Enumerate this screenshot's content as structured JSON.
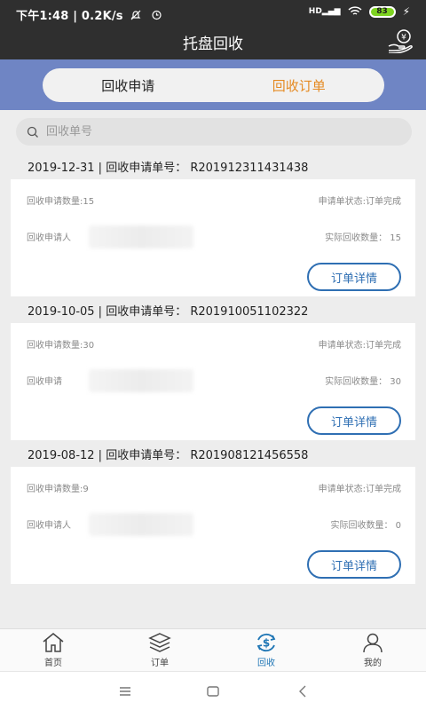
{
  "status_bar": {
    "left_text": "下午1:48 | 0.2K/s",
    "signal_text": "HD",
    "battery": "83"
  },
  "header": {
    "title": "托盘回收"
  },
  "tabs": [
    {
      "label": "回收申请",
      "active": true
    },
    {
      "label": "回收订单",
      "active": false
    }
  ],
  "search": {
    "placeholder": "回收单号"
  },
  "records": [
    {
      "header": "2019-12-31 | 回收申请单号：  R201912311431438",
      "quantity": "回收申请数量:15",
      "status": "申请单状态:订单完成",
      "applicant_label": "回收申请人",
      "actual": "实际回收数量：  15",
      "button": "订单详情"
    },
    {
      "header": "2019-10-05 | 回收申请单号：  R201910051102322",
      "quantity": "回收申请数量:30",
      "status": "申请单状态:订单完成",
      "applicant_label": "回收申请",
      "actual": "实际回收数量：  30",
      "button": "订单详情"
    },
    {
      "header": "2019-08-12 | 回收申请单号：  R201908121456558",
      "quantity": "回收申请数量:9",
      "status": "申请单状态:订单完成",
      "applicant_label": "回收申请人",
      "actual": "实际回收数量：  0",
      "button": "订单详情"
    }
  ],
  "bottom_nav": [
    {
      "label": "首页",
      "icon": "home-icon"
    },
    {
      "label": "订单",
      "icon": "layers-icon"
    },
    {
      "label": "回收",
      "icon": "recycle-dollar-icon",
      "active": true
    },
    {
      "label": "我的",
      "icon": "user-icon"
    }
  ],
  "colors": {
    "accent": "#1f76b5",
    "tab_band": "#6f85c4",
    "inactive_tab": "#e58a22",
    "header_bg": "#2f2f2f"
  }
}
